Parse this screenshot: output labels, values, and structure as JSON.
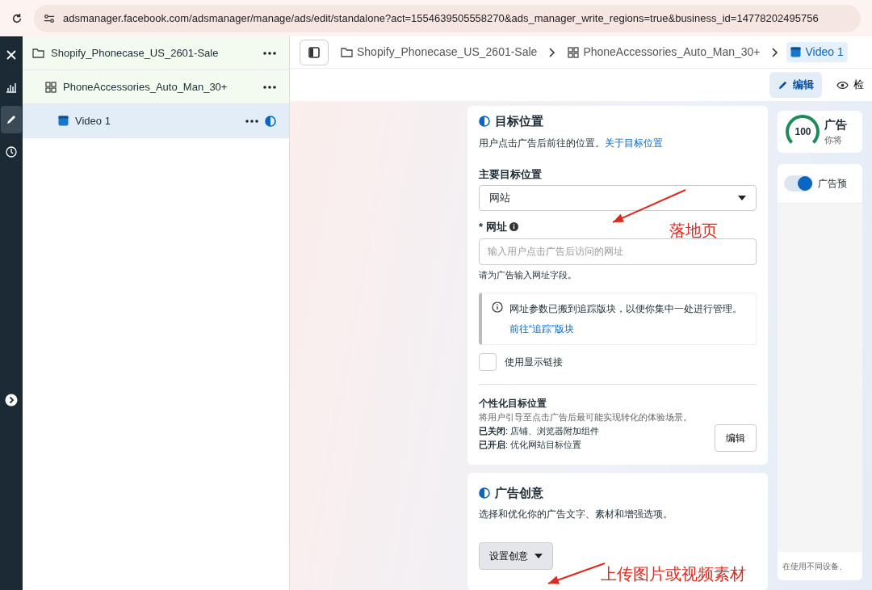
{
  "browser": {
    "url": "adsmanager.facebook.com/adsmanager/manage/ads/edit/standalone?act=1554639505558270&ads_manager_write_regions=true&business_id=14778202495756"
  },
  "rail": {
    "items": [
      {
        "kind": "close",
        "selected": false
      },
      {
        "kind": "chart",
        "selected": false
      },
      {
        "kind": "edit",
        "selected": true
      },
      {
        "kind": "history",
        "selected": false
      }
    ]
  },
  "tree": [
    {
      "kind": "campaign",
      "label": "Shopify_Phonecase_US_2601-Sale",
      "selected": false,
      "children": [
        {
          "kind": "adset",
          "label": "PhoneAccessories_Auto_Man_30+",
          "selected": false,
          "children": [
            {
              "kind": "ad",
              "label": "Video 1",
              "selected": true
            }
          ]
        }
      ]
    }
  ],
  "breadcrumb": [
    {
      "kind": "campaign",
      "label": "Shopify_Phonecase_US_2601-Sale",
      "selected": false
    },
    {
      "kind": "adset",
      "label": "PhoneAccessories_Auto_Man_30+",
      "selected": false
    },
    {
      "kind": "ad",
      "label": "Video 1",
      "selected": true
    }
  ],
  "toolbar": [
    {
      "kind": "edit",
      "label": "编辑",
      "selected": true
    },
    {
      "kind": "review",
      "label": "检",
      "selected": false
    }
  ],
  "destination": {
    "title": "目标位置",
    "description": "用户点击广告后前往的位置。",
    "link": "关于目标位置",
    "main_label": "主要目标位置",
    "main_value": "网站",
    "url_label": "* 网址",
    "url_placeholder": "输入用户点击广告后访问的网址",
    "url_error": "请为广告输入网址字段。",
    "notice": "网址参数已搬到追踪版块，以便你集中一处进行管理。",
    "notice_link": "前往“追踪”版块",
    "display_link": {
      "label": "使用显示链接",
      "checked": false
    },
    "personalize": {
      "title": "个性化目标位置",
      "description": "将用户引导至点击广告后最可能实现转化的体验场景。",
      "lines": [
        "**已关闭**: 店铺、浏览器附加组件",
        "**已开启**: 优化网站目标位置"
      ],
      "button": "编辑"
    }
  },
  "creative": {
    "title": "广告创意",
    "description": "选择和优化你的广告文字、素材和增强选项。",
    "button": "设置创意"
  },
  "side": {
    "score": "100",
    "title": "广告",
    "subtitle": "你将",
    "preview_label": "广告预",
    "preview_on": true,
    "footer": "在使用不同设备、"
  },
  "annotations": [
    "落地页",
    "上传图片或视频素材"
  ]
}
